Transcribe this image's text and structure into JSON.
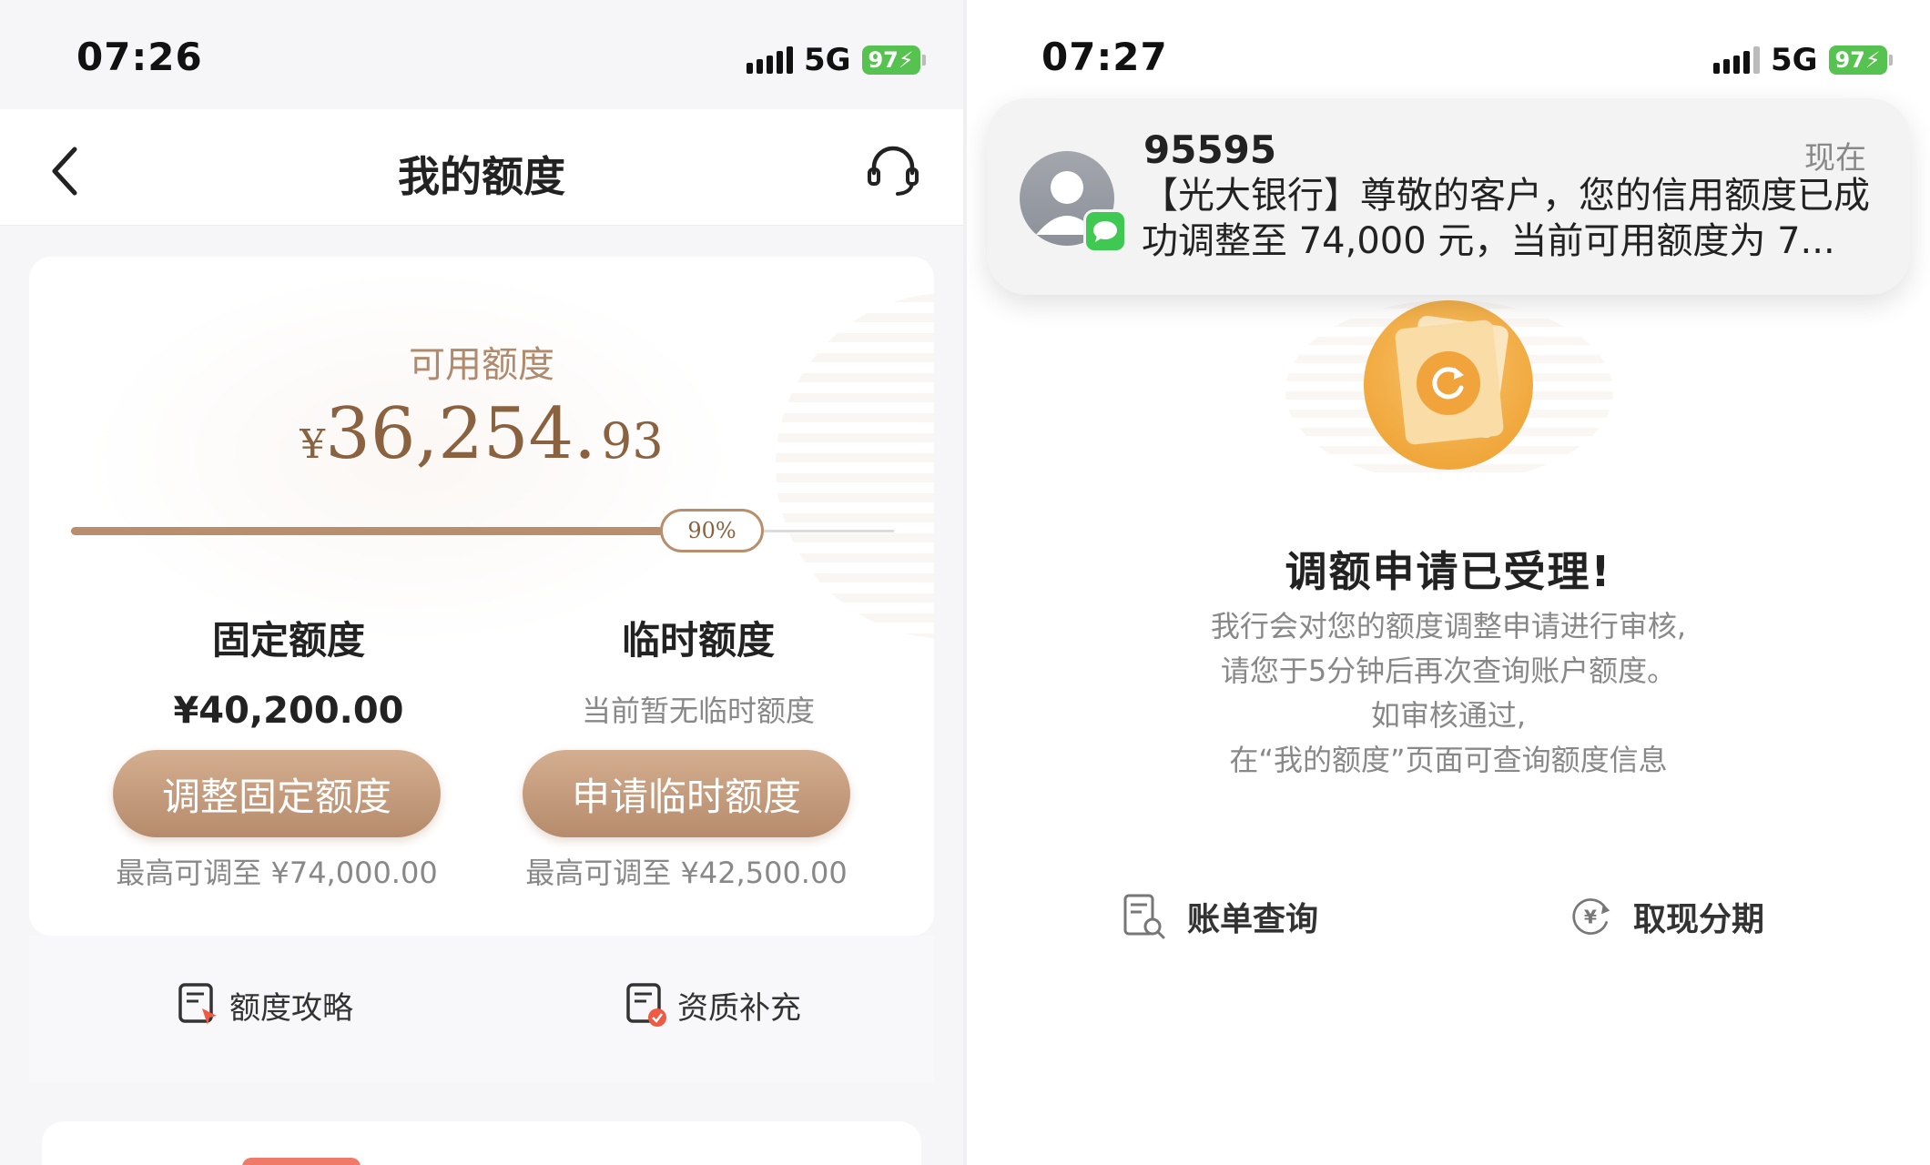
{
  "left": {
    "status": {
      "time": "07:26",
      "network": "5G",
      "battery": "97"
    },
    "header": {
      "title": "我的额度"
    },
    "available": {
      "label": "可用额度",
      "currency": "¥",
      "amount_int": "36,254.",
      "amount_dec": "93",
      "usage_percent_label": "90%",
      "usage_fraction": 0.9
    },
    "fixed": {
      "title": "固定额度",
      "value": "¥40,200.00",
      "button": "调整固定额度",
      "max_note": "最高可调至 ¥74,000.00"
    },
    "temporary": {
      "title": "临时额度",
      "note": "当前暂无临时额度",
      "button": "申请临时额度",
      "max_note": "最高可调至 ¥42,500.00"
    },
    "links": [
      {
        "label": "额度攻略",
        "icon": "document-pointer-icon"
      },
      {
        "label": "资质补充",
        "icon": "document-check-icon"
      }
    ]
  },
  "right": {
    "status": {
      "time": "07:27",
      "network": "5G",
      "battery": "97"
    },
    "notification": {
      "sender": "95595",
      "time": "现在",
      "body": "【光大银行】尊敬的客户，您的信用额度已成功调整至 74,000 元，当前可用额度为 7..."
    },
    "result": {
      "title": "调额申请已受理!",
      "lines": [
        "我行会对您的额度调整申请进行审核,",
        "请您于5分钟后再次查询账户额度。",
        "如审核通过,",
        "在“我的额度”页面可查询额度信息"
      ]
    },
    "actions": [
      {
        "label": "账单查询",
        "icon": "bill-search-icon"
      },
      {
        "label": "取现分期",
        "icon": "yen-cycle-icon"
      }
    ]
  },
  "colors": {
    "accent_brown": "#b98e6c",
    "amount_brown": "#8a6240",
    "battery_green": "#56c24f",
    "message_green": "#3fc953"
  }
}
